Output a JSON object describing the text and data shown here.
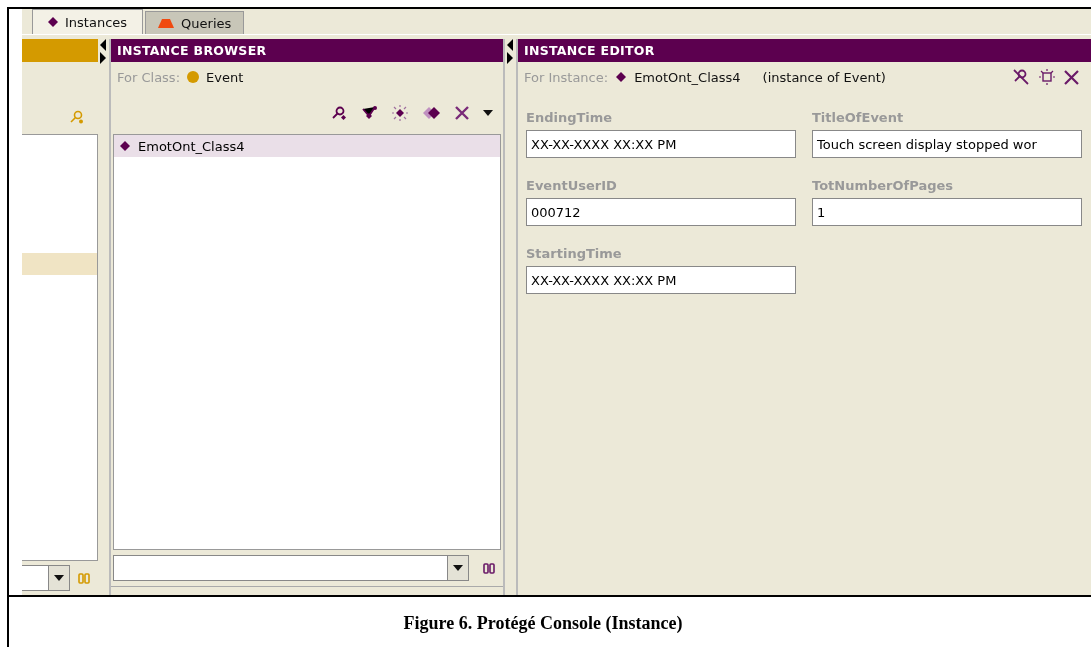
{
  "tabs": [
    {
      "label": "Instances",
      "kind": "instances",
      "selected": true
    },
    {
      "label": "Queries",
      "kind": "queries",
      "selected": false
    }
  ],
  "class_tree": {
    "rows": [
      {
        "selected": true
      }
    ]
  },
  "instance_browser": {
    "title": "INSTANCE BROWSER",
    "for_label": "For Class:",
    "class_name": "Event",
    "instances": [
      {
        "name": "EmotOnt_Class4",
        "selected": true
      }
    ]
  },
  "instance_editor": {
    "title": "INSTANCE EDITOR",
    "for_label": "For Instance:",
    "instance_name": "EmotOnt_Class4",
    "instance_of": "(instance of Event)",
    "fields": [
      {
        "label": "EndingTime",
        "value": "XX-XX-XXXX XX:XX PM"
      },
      {
        "label": "TitleOfEvent",
        "value": "Touch screen display stopped wor"
      },
      {
        "label": "EventUserID",
        "value": "000712"
      },
      {
        "label": "TotNumberOfPages",
        "value": "1"
      },
      {
        "label": "StartingTime",
        "value": "XX-XX-XXXX XX:XX PM"
      }
    ]
  },
  "caption": "Figure 6. Protégé Console (Instance)"
}
